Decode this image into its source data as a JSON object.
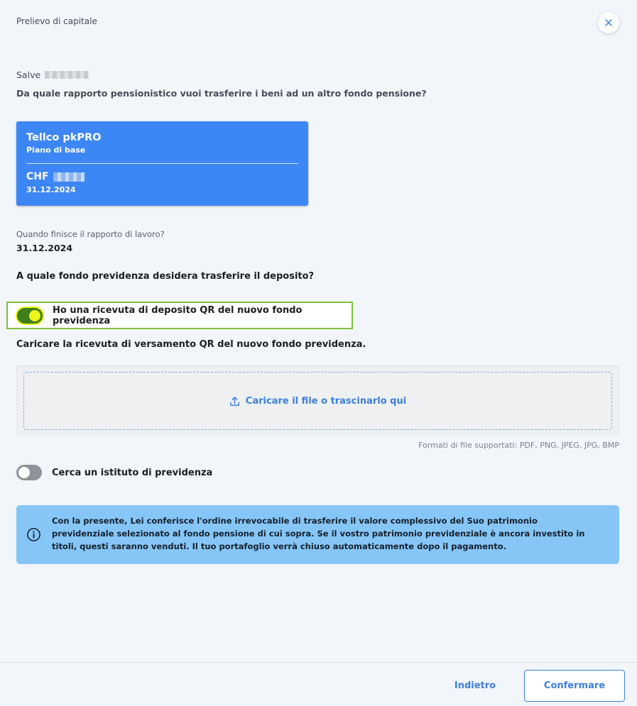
{
  "header": {
    "title": "Prelievo di capitale"
  },
  "greeting": {
    "prefix": "Salve"
  },
  "question_account": "Da quale rapporto pensionistico vuoi trasferire i beni ad un altro fondo pensione?",
  "account_card": {
    "name": "Tellco pkPRO",
    "plan": "Piano di base",
    "currency": "CHF",
    "date": "31.12.2024",
    "color": "#3d86f5"
  },
  "employment_end": {
    "label": "Quando finisce il rapporto di lavoro?",
    "value": "31.12.2024"
  },
  "question_fund": "A quale fondo previdenza desidera trasferire il deposito?",
  "qr_toggle": {
    "label": "Ho una ricevuta di deposito QR del nuovo fondo previdenza",
    "checked": true
  },
  "upload": {
    "heading": "Caricare la ricevuta di versamento QR del nuovo fondo previdenza.",
    "action_text": "Caricare il file  o trascinarlo qui",
    "formats": "Formati di file supportati: PDF, PNG, JPEG, JPG, BMP",
    "icon": "upload-icon"
  },
  "search_toggle": {
    "label": "Cerca un istituto di previdenza",
    "checked": false
  },
  "info": {
    "icon": "info-icon",
    "text": "Con la presente, Lei conferisce l'ordine irrevocabile di trasferire il valore complessivo del Suo patrimonio previdenziale selezionato al fondo pensione di cui sopra. Se il vostro patrimonio previdenziale è ancora investito in titoli, questi saranno venduti. Il tuo portafoglio verrà chiuso automaticamente dopo il pagamento."
  },
  "footer": {
    "back_label": "Indietro",
    "confirm_label": "Confermare"
  },
  "colors": {
    "accent": "#3d7fd9",
    "info_bg": "#86c6f7",
    "toggle_on": "#3f7d1b"
  }
}
